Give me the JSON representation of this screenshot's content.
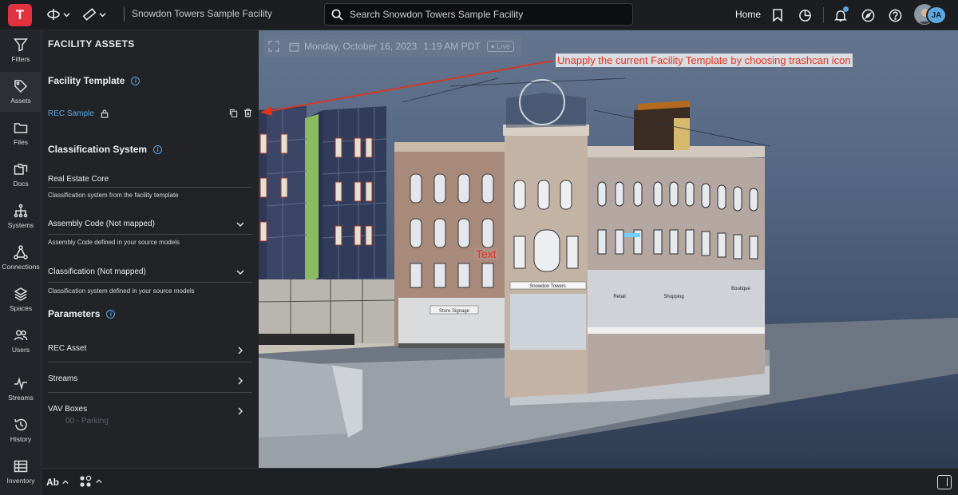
{
  "header": {
    "logo_letter": "T",
    "facility_name": "Snowdon Towers Sample Facility",
    "search_placeholder": "Search Snowdon Towers Sample Facility",
    "home_label": "Home",
    "avatar_initials": "JA"
  },
  "rail": {
    "items": [
      {
        "label": "Filters",
        "icon": "filter-icon"
      },
      {
        "label": "Assets",
        "icon": "tag-icon"
      },
      {
        "label": "Files",
        "icon": "folder-icon"
      },
      {
        "label": "Docs",
        "icon": "docs-icon"
      },
      {
        "label": "Systems",
        "icon": "systems-icon"
      },
      {
        "label": "Connections",
        "icon": "connections-icon"
      },
      {
        "label": "Spaces",
        "icon": "layers-icon"
      },
      {
        "label": "Users",
        "icon": "users-icon"
      },
      {
        "label": "Streams",
        "icon": "pulse-icon"
      },
      {
        "label": "History",
        "icon": "history-icon"
      },
      {
        "label": "Inventory",
        "icon": "table-icon"
      }
    ],
    "active": "Assets"
  },
  "panel": {
    "title": "FACILITY ASSETS",
    "facility_template": {
      "heading": "Facility Template",
      "template_name": "REC Sample"
    },
    "classification_system": {
      "heading": "Classification System",
      "rows": [
        {
          "title": "Real Estate Core",
          "subtitle": "Classification system from the facility template"
        },
        {
          "title": "Assembly Code (Not mapped)",
          "subtitle": "Assembly Code defined in your source models"
        },
        {
          "title": "Classification (Not mapped)",
          "subtitle": "Classification system defined in your source models"
        }
      ]
    },
    "parameters": {
      "heading": "Parameters",
      "rows": [
        "REC Asset",
        "Streams",
        "VAV Boxes"
      ]
    }
  },
  "viewport": {
    "date": "Monday, October 16, 2023",
    "time": "1:19 AM PDT",
    "live_label": "Live",
    "annotation": "Unapply the current Facility Template by choosing trashcan icon",
    "text_label": "Text",
    "signs": {
      "storefront": "Snowdon Towers",
      "store_signage": "Store Signage",
      "retail": "Retail",
      "shopping": "Shopping",
      "boutique": "Boutique"
    },
    "underlay_labels": [
      "00 - Parking"
    ]
  },
  "footer": {
    "text_tool": "Ab"
  },
  "colors": {
    "accent": "#5aa6e0",
    "logo": "#e0323f",
    "annotation": "#e0341f"
  }
}
